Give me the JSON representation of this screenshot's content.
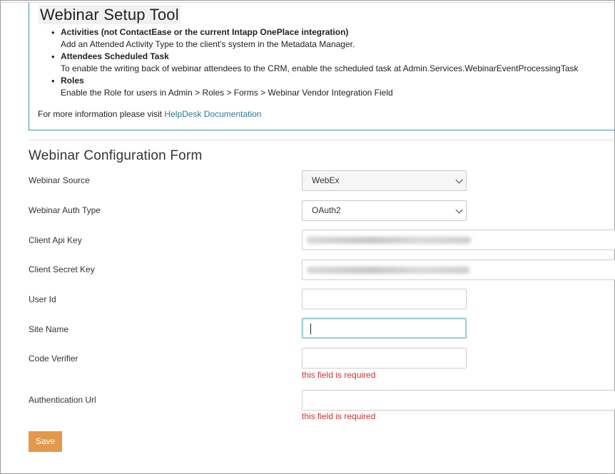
{
  "setup": {
    "title": "Webinar Setup Tool",
    "items": [
      {
        "heading": "Activities (not ContactEase or the current Intapp OnePlace integration)",
        "text": "Add an Attended Activity Type to the client's system in the Metadata Manager."
      },
      {
        "heading": "Attendees Scheduled Task",
        "text": "To enable the writing back of webinar attendees to the CRM, enable the scheduled task at Admin.Services.WebinarEventProcessingTask"
      },
      {
        "heading": "Roles",
        "text": "Enable the Role for users in Admin > Roles > Forms > Webinar Vendor Integration Field"
      }
    ],
    "more_info_prefix": "For more information please visit ",
    "more_info_link": "HelpDesk Documentation"
  },
  "form": {
    "title": "Webinar Configuration Form",
    "webinar_source_label": "Webinar Source",
    "webinar_source_value": "WebEx",
    "auth_type_label": "Webinar Auth Type",
    "auth_type_value": "OAuth2",
    "client_api_key_label": "Client Api Key",
    "client_secret_key_label": "Client Secret Key",
    "user_id_label": "User Id",
    "site_name_label": "Site Name",
    "code_verifier_label": "Code Verifier",
    "code_verifier_error": "this field is required",
    "auth_url_label": "Authentication Url",
    "auth_url_error": "this field is required",
    "save_label": "Save"
  }
}
